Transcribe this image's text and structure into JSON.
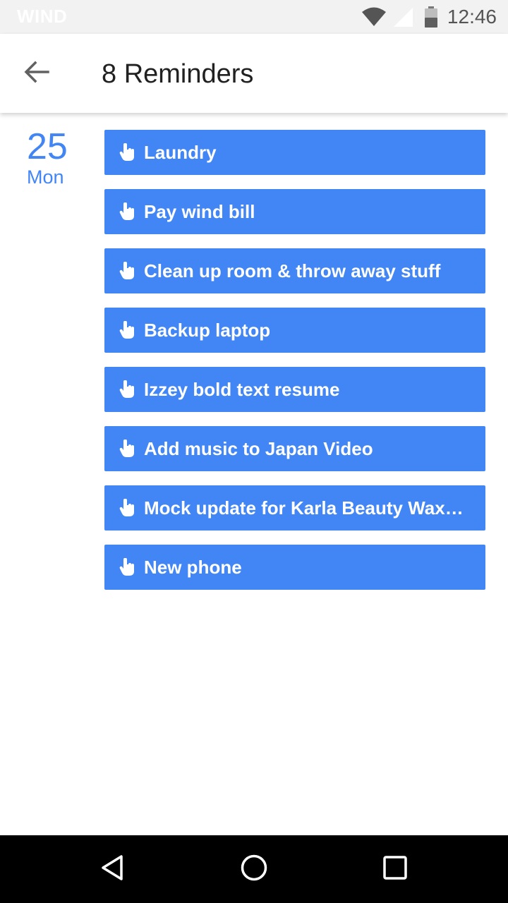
{
  "status_bar": {
    "carrier": "WIND",
    "time": "12:46",
    "icons": [
      "wifi-icon",
      "signal-icon",
      "battery-icon"
    ]
  },
  "app_bar": {
    "title": "8 Reminders",
    "back_icon": "arrow-left-icon"
  },
  "date": {
    "day": "25",
    "weekday": "Mon"
  },
  "reminders": [
    {
      "label": "Laundry",
      "icon": "hand-pointer-icon"
    },
    {
      "label": "Pay wind bill",
      "icon": "hand-pointer-icon"
    },
    {
      "label": "Clean up room & throw away stuff",
      "icon": "hand-pointer-icon"
    },
    {
      "label": "Backup laptop",
      "icon": "hand-pointer-icon"
    },
    {
      "label": "Izzey bold text resume",
      "icon": "hand-pointer-icon"
    },
    {
      "label": "Add music to Japan Video",
      "icon": "hand-pointer-icon"
    },
    {
      "label": "Mock update for Karla Beauty Wax…",
      "icon": "hand-pointer-icon"
    },
    {
      "label": "New phone",
      "icon": "hand-pointer-icon"
    }
  ],
  "nav_bar": {
    "buttons": [
      "nav-back-icon",
      "nav-home-icon",
      "nav-recents-icon"
    ]
  },
  "colors": {
    "accent": "#4285f4",
    "status_bar_bg": "#f2f2f2",
    "nav_bar_bg": "#000000",
    "title_text": "#212121"
  }
}
